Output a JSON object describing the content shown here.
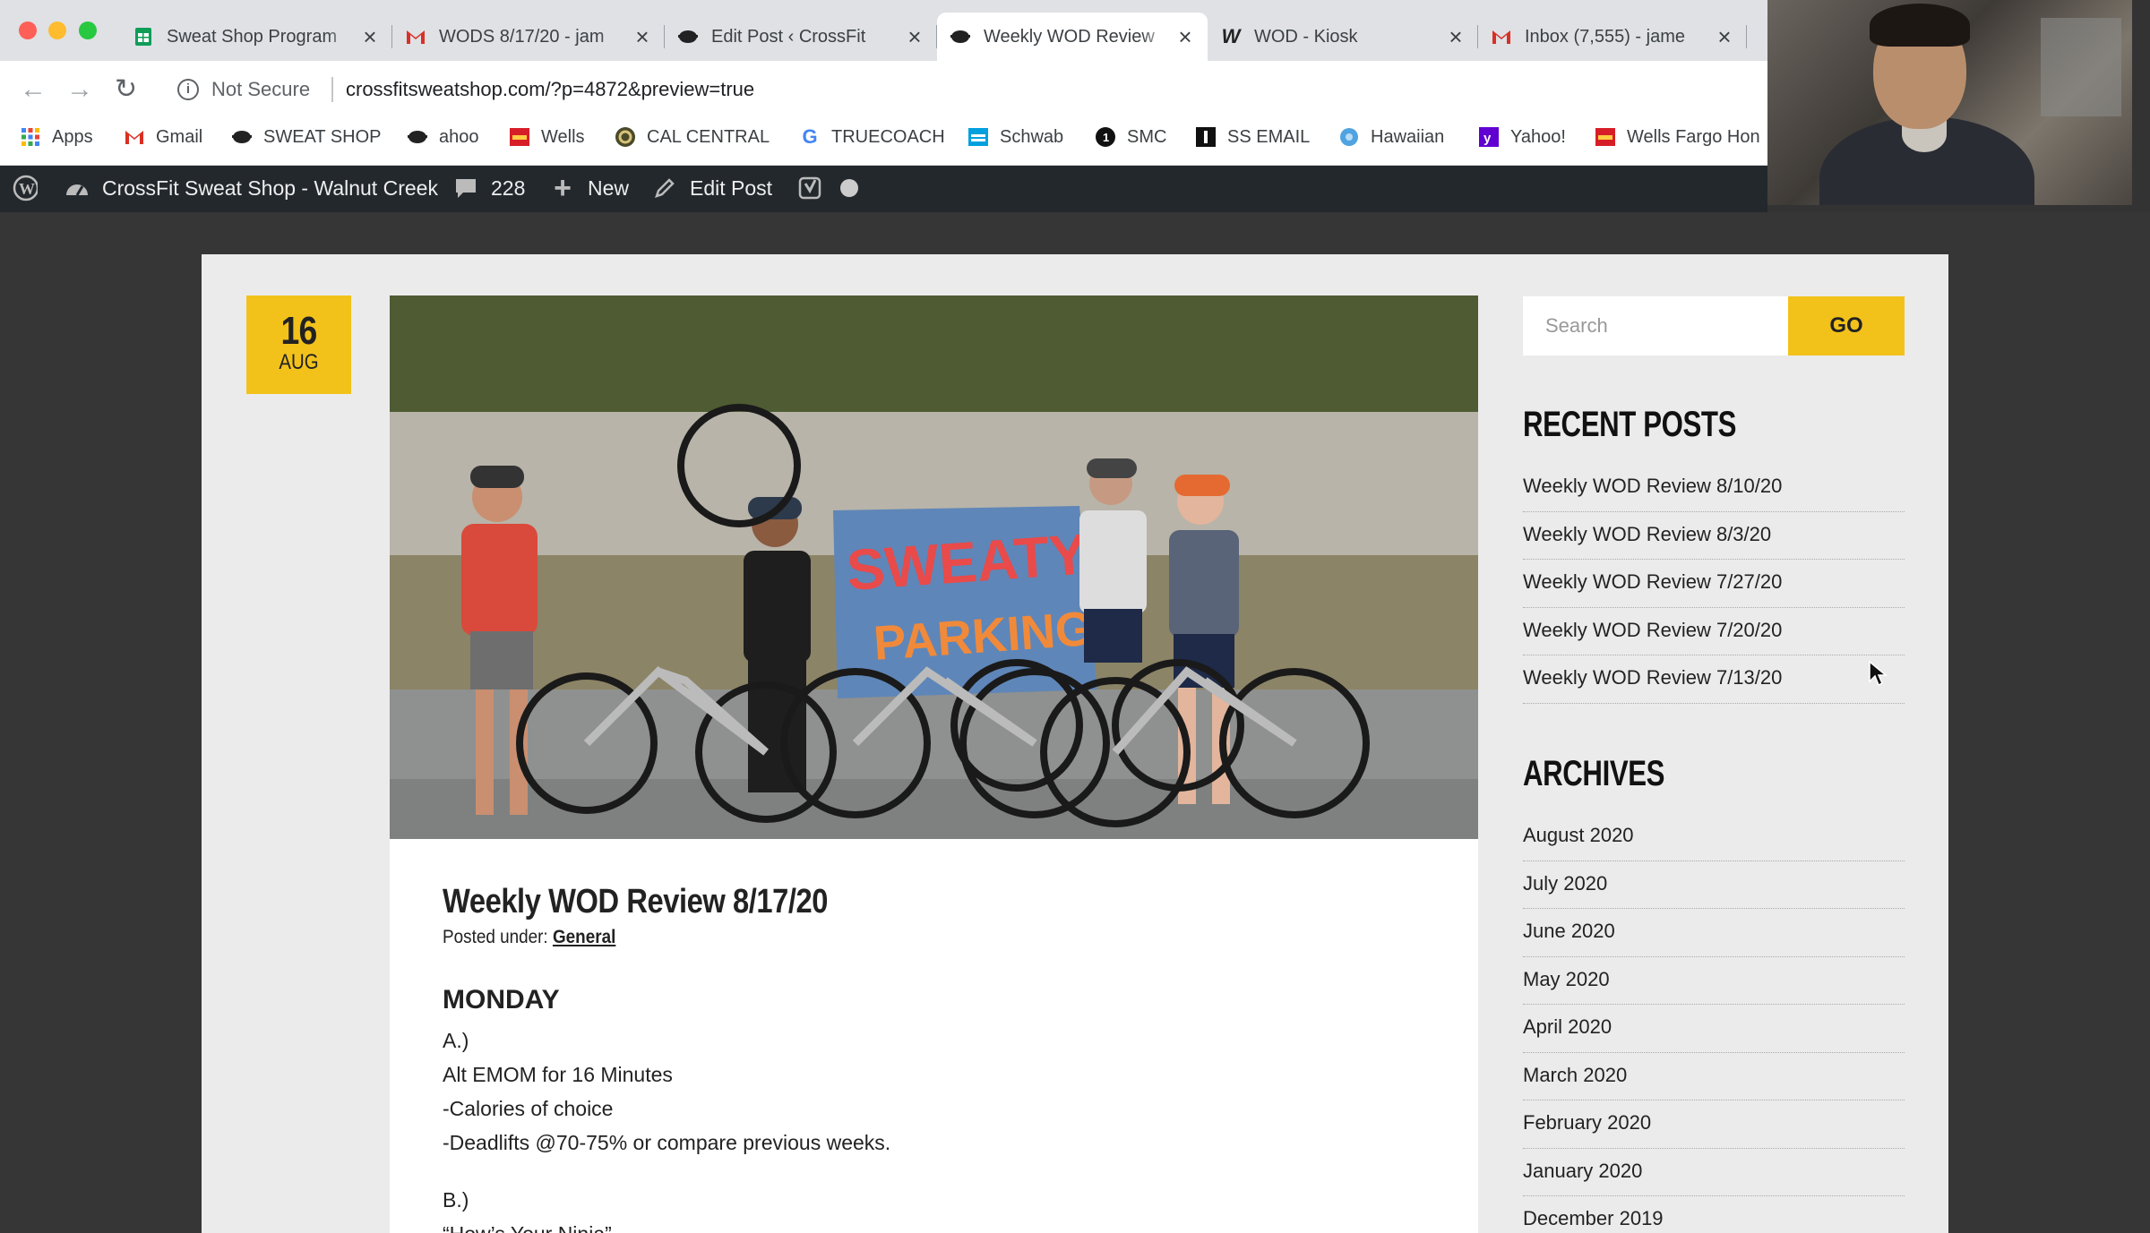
{
  "browser": {
    "tabs": [
      {
        "title": "Sweat Shop Program",
        "icon": "google-sheets-icon",
        "active": false
      },
      {
        "title": "WODS 8/17/20 - jam",
        "icon": "gmail-icon",
        "active": false
      },
      {
        "title": "Edit Post ‹ CrossFit",
        "icon": "sweat-shop-icon",
        "active": false
      },
      {
        "title": "Weekly WOD Review",
        "icon": "sweat-shop-icon",
        "active": true
      },
      {
        "title": "WOD - Kiosk",
        "icon": "wodify-icon",
        "active": false
      },
      {
        "title": "Inbox (7,555) - jame",
        "icon": "gmail-icon",
        "active": false
      }
    ],
    "security_label": "Not Secure",
    "url": "crossfitsweatshop.com/?p=4872&preview=true",
    "bookmarks": [
      {
        "label": "Apps",
        "icon": "apps-grid-icon"
      },
      {
        "label": "Gmail",
        "icon": "gmail-icon"
      },
      {
        "label": "SWEAT SHOP",
        "icon": "sweat-shop-icon"
      },
      {
        "label": "ahoo",
        "icon": "sweat-shop-icon"
      },
      {
        "label": "Wells",
        "icon": "wells-fargo-icon"
      },
      {
        "label": "CAL CENTRAL",
        "icon": "cal-central-icon"
      },
      {
        "label": "TRUECOACH",
        "icon": "google-icon"
      },
      {
        "label": "Schwab",
        "icon": "schwab-icon"
      },
      {
        "label": "SMC",
        "icon": "smc-icon"
      },
      {
        "label": "SS EMAIL",
        "icon": "ss-email-icon"
      },
      {
        "label": "Hawaiian",
        "icon": "hawaiian-icon"
      },
      {
        "label": "Yahoo!",
        "icon": "yahoo-icon"
      },
      {
        "label": "Wells Fargo Hon",
        "icon": "wells-fargo-icon"
      }
    ]
  },
  "admin_bar": {
    "site_name": "CrossFit Sweat Shop - Walnut Creek",
    "comments_count": "228",
    "new_label": "New",
    "edit_post_label": "Edit Post"
  },
  "post": {
    "date_day": "16",
    "date_month": "AUG",
    "hero_sign_text": "SWEATY PARKING",
    "title": "Weekly WOD Review 8/17/20",
    "posted_under_label": "Posted under:",
    "category": "General",
    "day_heading": "MONDAY",
    "lines": [
      "A.)",
      "Alt EMOM for 16 Minutes",
      "-Calories of choice",
      "-Deadlifts @70-75% or compare previous weeks.",
      "B.)",
      "“How’s Your Ninja”"
    ]
  },
  "sidebar": {
    "search_placeholder": "Search",
    "go_label": "GO",
    "recent_posts_heading": "RECENT POSTS",
    "recent_posts": [
      "Weekly WOD Review 8/10/20",
      "Weekly WOD Review 8/3/20",
      "Weekly WOD Review 7/27/20",
      "Weekly WOD Review 7/20/20",
      "Weekly WOD Review 7/13/20"
    ],
    "archives_heading": "ARCHIVES",
    "archives": [
      "August 2020",
      "July 2020",
      "June 2020",
      "May 2020",
      "April 2020",
      "March 2020",
      "February 2020",
      "January 2020",
      "December 2019"
    ]
  },
  "colors": {
    "accent_yellow": "#f2c21b",
    "admin_bar": "#23282d",
    "page_background": "#363636"
  }
}
